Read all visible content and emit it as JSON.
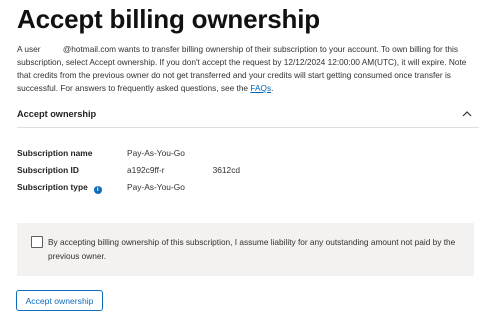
{
  "page": {
    "title": "Accept billing ownership"
  },
  "intro": {
    "prefix": "A user",
    "email_suffix": "@hotmail.com wants to transfer billing ownership of their subscription to your account. To own billing for this subscription, select Accept ownership. If you don't accept the request by 12/12/2024 12:00:00 AM(UTC), it will expire. Note that credits from the previous owner do not get transferred and your credits will start getting consumed once transfer is successful. For answers to frequently asked questions, see the",
    "faq_link": "FAQs",
    "end": "."
  },
  "section": {
    "title": "Accept ownership",
    "chevron_icon": "chevron-up-icon"
  },
  "details": [
    {
      "label": "Subscription name",
      "value": "Pay-As-You-Go"
    },
    {
      "label": "Subscription ID",
      "value_start": "a192c9ff-r",
      "value_end": "3612cd"
    },
    {
      "label": "Subscription type",
      "value": "Pay-As-You-Go",
      "info_icon": "info-icon"
    }
  ],
  "consent": {
    "text": "By accepting billing ownership of this subscription, I assume liability for any outstanding amount not paid by the previous owner.",
    "checked": false
  },
  "actions": {
    "accept_label": "Accept ownership"
  },
  "colors": {
    "accent": "#0f6cbd",
    "consent_background": "#f3f2f1"
  }
}
